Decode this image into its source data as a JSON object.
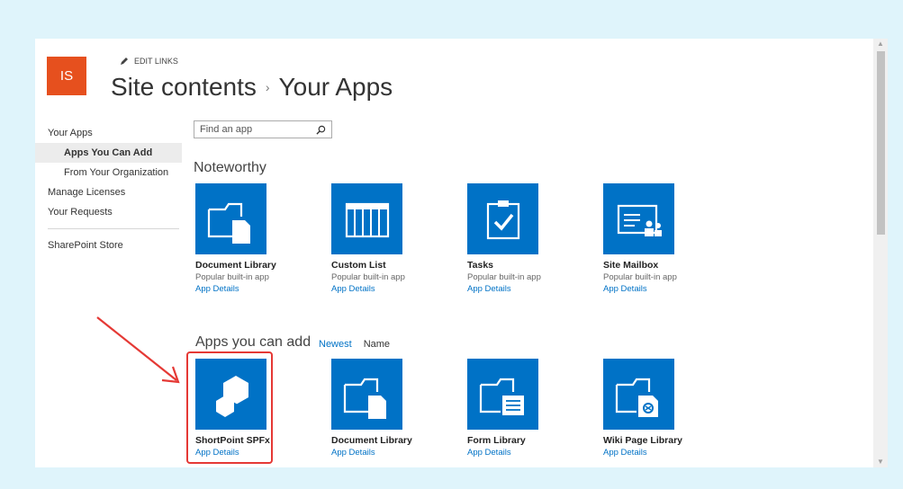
{
  "site": {
    "logo_text": "IS"
  },
  "header": {
    "edit_links": "EDIT LINKS",
    "title_part1": "Site contents",
    "title_separator": "›",
    "title_part2": "Your Apps"
  },
  "leftnav": {
    "items": [
      {
        "label": "Your Apps"
      },
      {
        "label": "Apps You Can Add"
      },
      {
        "label": "From Your Organization"
      },
      {
        "label": "Manage Licenses"
      },
      {
        "label": "Your Requests"
      },
      {
        "label": "SharePoint Store"
      }
    ]
  },
  "search": {
    "placeholder": "Find an app"
  },
  "noteworthy": {
    "title": "Noteworthy",
    "apps": [
      {
        "name": "Document Library",
        "subtitle": "Popular built-in app",
        "link": "App Details",
        "icon": "document-library-icon"
      },
      {
        "name": "Custom List",
        "subtitle": "Popular built-in app",
        "link": "App Details",
        "icon": "custom-list-icon"
      },
      {
        "name": "Tasks",
        "subtitle": "Popular built-in app",
        "link": "App Details",
        "icon": "tasks-icon"
      },
      {
        "name": "Site Mailbox",
        "subtitle": "Popular built-in app",
        "link": "App Details",
        "icon": "site-mailbox-icon"
      }
    ]
  },
  "apps_you_can_add": {
    "title": "Apps you can add",
    "sort_newest": "Newest",
    "sort_name": "Name",
    "apps": [
      {
        "name": "ShortPoint SPFx",
        "link": "App Details",
        "icon": "shortpoint-icon"
      },
      {
        "name": "Document Library",
        "link": "App Details",
        "icon": "document-library-icon"
      },
      {
        "name": "Form Library",
        "link": "App Details",
        "icon": "form-library-icon"
      },
      {
        "name": "Wiki Page Library",
        "link": "App Details",
        "icon": "wiki-page-library-icon"
      }
    ]
  },
  "colors": {
    "brand_tile": "#0072c6",
    "logo": "#e6501e",
    "annotation": "#e53935",
    "link": "#0072c6"
  }
}
